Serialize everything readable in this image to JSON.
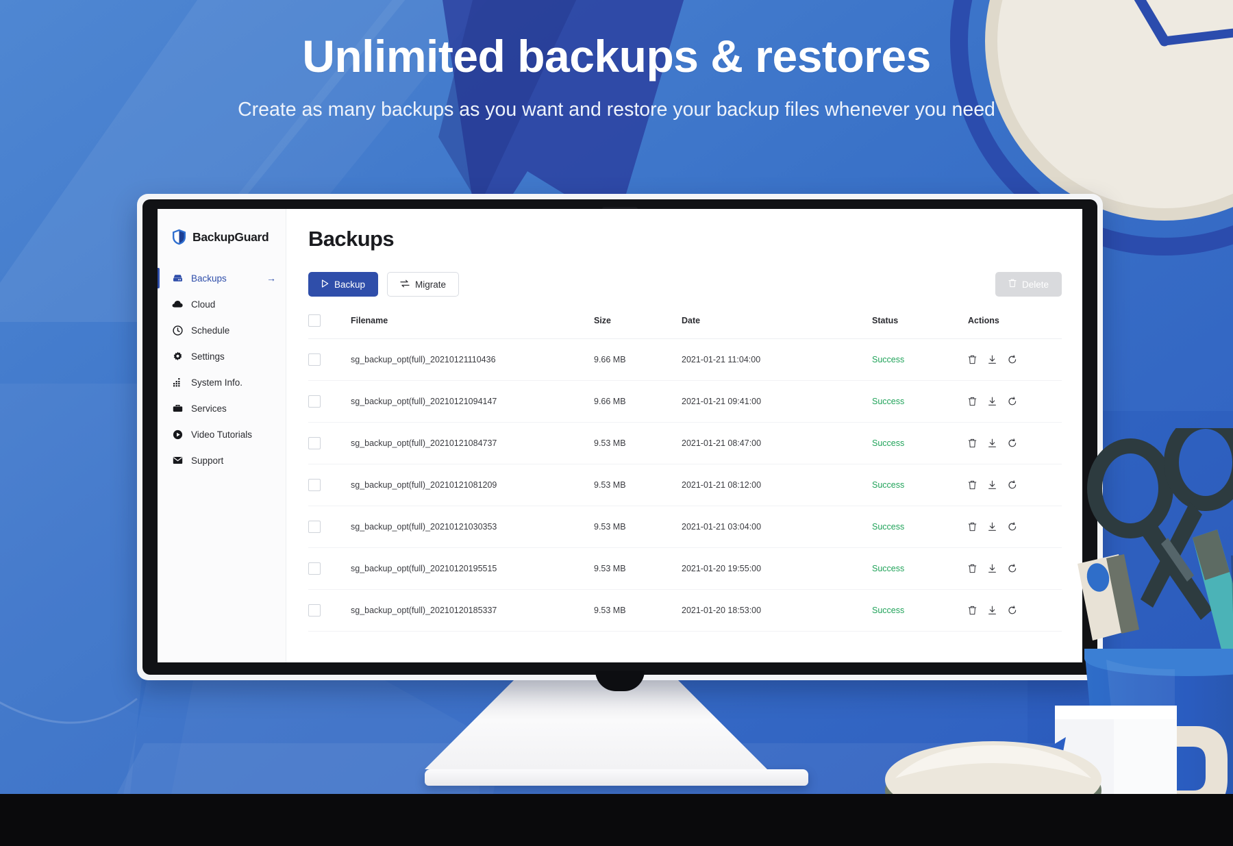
{
  "banner": {
    "headline": "Unlimited backups & restores",
    "subhead": "Create as many backups as you want and restore your backup files whenever you need",
    "brand_blue": "#2f4eaa",
    "bg_blue": "#2b5fc4"
  },
  "app": {
    "brand": {
      "name": "BackupGuard",
      "icon": "shield-icon"
    },
    "sidebar": {
      "items": [
        {
          "label": "Backups",
          "icon": "server-icon",
          "active": true,
          "arrow": "→"
        },
        {
          "label": "Cloud",
          "icon": "cloud-icon",
          "active": false
        },
        {
          "label": "Schedule",
          "icon": "clock-icon",
          "active": false
        },
        {
          "label": "Settings",
          "icon": "gear-icon",
          "active": false
        },
        {
          "label": "System Info.",
          "icon": "chart-bars-icon",
          "active": false
        },
        {
          "label": "Services",
          "icon": "briefcase-icon",
          "active": false
        },
        {
          "label": "Video Tutorials",
          "icon": "play-circle-icon",
          "active": false
        },
        {
          "label": "Support",
          "icon": "envelope-icon",
          "active": false
        }
      ]
    },
    "page_title": "Backups",
    "toolbar": {
      "backup_label": "Backup",
      "backup_icon": "play-icon",
      "migrate_label": "Migrate",
      "migrate_icon": "transfer-icon",
      "delete_label": "Delete",
      "delete_icon": "trash-icon",
      "delete_disabled": true
    },
    "table": {
      "columns": [
        "Filename",
        "Size",
        "Date",
        "Status",
        "Actions"
      ],
      "row_actions": [
        "trash-icon",
        "download-icon",
        "restore-icon"
      ],
      "rows": [
        {
          "filename": "sg_backup_opt(full)_20210121110436",
          "size": "9.66 MB",
          "date": "2021-01-21 11:04:00",
          "status": "Success"
        },
        {
          "filename": "sg_backup_opt(full)_20210121094147",
          "size": "9.66 MB",
          "date": "2021-01-21 09:41:00",
          "status": "Success"
        },
        {
          "filename": "sg_backup_opt(full)_20210121084737",
          "size": "9.53 MB",
          "date": "2021-01-21 08:47:00",
          "status": "Success"
        },
        {
          "filename": "sg_backup_opt(full)_20210121081209",
          "size": "9.53 MB",
          "date": "2021-01-21 08:12:00",
          "status": "Success"
        },
        {
          "filename": "sg_backup_opt(full)_20210121030353",
          "size": "9.53 MB",
          "date": "2021-01-21 03:04:00",
          "status": "Success"
        },
        {
          "filename": "sg_backup_opt(full)_20210120195515",
          "size": "9.53 MB",
          "date": "2021-01-20 19:55:00",
          "status": "Success"
        },
        {
          "filename": "sg_backup_opt(full)_20210120185337",
          "size": "9.53 MB",
          "date": "2021-01-20 18:53:00",
          "status": "Success"
        }
      ]
    },
    "status_color": "#21a35a"
  },
  "decor": {
    "items": [
      "clock",
      "scissors",
      "pencils",
      "pencil-cup",
      "mug",
      "computer-mouse"
    ]
  }
}
